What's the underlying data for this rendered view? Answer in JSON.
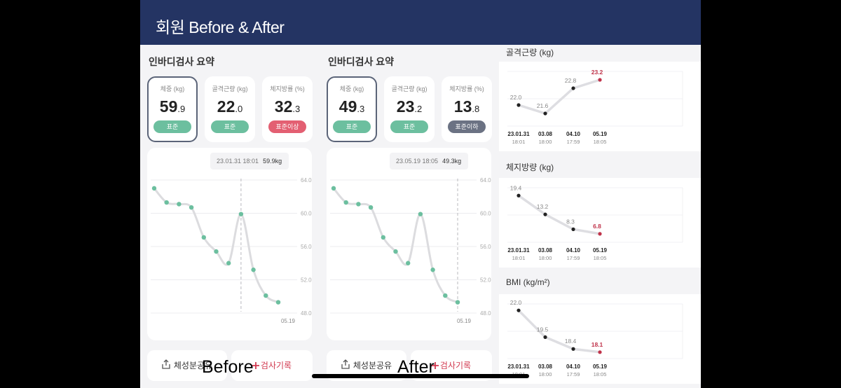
{
  "header": {
    "title": "회원 Before & After"
  },
  "columns": [
    {
      "key": "before",
      "title": "인바디검사 요약",
      "metrics": [
        {
          "label": "체중 (kg)",
          "int": "59",
          "dec": ".9",
          "badge": "표준",
          "badge_color": "#6cbf9f",
          "selected": true
        },
        {
          "label": "골격근량 (kg)",
          "int": "22",
          "dec": ".0",
          "badge": "표준",
          "badge_color": "#6cbf9f",
          "selected": false
        },
        {
          "label": "체지방률 (%)",
          "int": "32",
          "dec": ".3",
          "badge": "표준이상",
          "badge_color": "#e35f72",
          "selected": false
        }
      ],
      "tooltip": {
        "date": "23.01.31 18:01",
        "value": "59.9kg"
      },
      "y_ticks": [
        "64.0",
        "60.0",
        "56.0",
        "52.0",
        "48.0"
      ],
      "x_label": "05.19",
      "chart_data": {
        "type": "line",
        "series": [
          {
            "values": [
              63.0,
              61.3,
              61.1,
              60.7,
              57.1,
              55.4,
              54.0,
              59.9,
              53.2,
              50.1,
              49.3
            ]
          }
        ],
        "ylim": [
          48,
          64
        ],
        "highlight_index": 7
      },
      "share_label": "체성분공유",
      "record_label": "검사기록"
    },
    {
      "key": "after",
      "title": "인바디검사 요약",
      "metrics": [
        {
          "label": "체중 (kg)",
          "int": "49",
          "dec": ".3",
          "badge": "표준",
          "badge_color": "#6cbf9f",
          "selected": true
        },
        {
          "label": "골격근량 (kg)",
          "int": "23",
          "dec": ".2",
          "badge": "표준",
          "badge_color": "#6cbf9f",
          "selected": false
        },
        {
          "label": "체지방률 (%)",
          "int": "13",
          "dec": ".8",
          "badge": "표준이하",
          "badge_color": "#6b7283",
          "selected": false
        }
      ],
      "tooltip": {
        "date": "23.05.19 18:05",
        "value": "49.3kg"
      },
      "y_ticks": [
        "64.0",
        "60.0",
        "56.0",
        "52.0",
        "48.0"
      ],
      "x_label": "05.19",
      "chart_data": {
        "type": "line",
        "series": [
          {
            "values": [
              63.0,
              61.3,
              61.1,
              60.7,
              57.1,
              55.4,
              54.0,
              59.9,
              53.2,
              50.1,
              49.3
            ]
          }
        ],
        "ylim": [
          48,
          64
        ],
        "highlight_index": 10
      },
      "share_label": "체성분공유",
      "record_label": "검사기록"
    }
  ],
  "mini_charts": [
    {
      "title": "골격근량 (kg)",
      "chart_data": {
        "type": "line",
        "series": [
          {
            "values": [
              22.0,
              21.6,
              22.8,
              23.2
            ]
          }
        ],
        "labels": [
          "22.0",
          "21.6",
          "22.8",
          "23.2"
        ],
        "dates": [
          "23.01.31",
          "03.08",
          "04.10",
          "05.19"
        ],
        "times": [
          "18:01",
          "18:00",
          "17:59",
          "18:05"
        ],
        "ylim": [
          21.0,
          23.6
        ]
      }
    },
    {
      "title": "체지방량 (kg)",
      "chart_data": {
        "type": "line",
        "series": [
          {
            "values": [
              19.4,
              13.2,
              8.3,
              6.8
            ]
          }
        ],
        "labels": [
          "19.4",
          "13.2",
          "8.3",
          "6.8"
        ],
        "dates": [
          "23.01.31",
          "03.08",
          "04.10",
          "05.19"
        ],
        "times": [
          "18:01",
          "18:00",
          "17:59",
          "18:05"
        ],
        "ylim": [
          4.0,
          22.0
        ]
      }
    },
    {
      "title": "BMI (kg/m²)",
      "chart_data": {
        "type": "line",
        "series": [
          {
            "values": [
              22.0,
              19.5,
              18.4,
              18.1
            ]
          }
        ],
        "labels": [
          "22.0",
          "19.5",
          "18.4",
          "18.1"
        ],
        "dates": [
          "23.01.31",
          "03.08",
          "04.10",
          "05.19"
        ],
        "times": [
          "18:01",
          "18:00",
          "17:59",
          "18:05"
        ],
        "ylim": [
          17.5,
          22.6
        ]
      }
    }
  ],
  "overlay": {
    "before": "Before",
    "after": "After"
  },
  "colors": {
    "accent_green": "#6cbf9f",
    "accent_red": "#c0334a",
    "header_bg": "#243463"
  }
}
